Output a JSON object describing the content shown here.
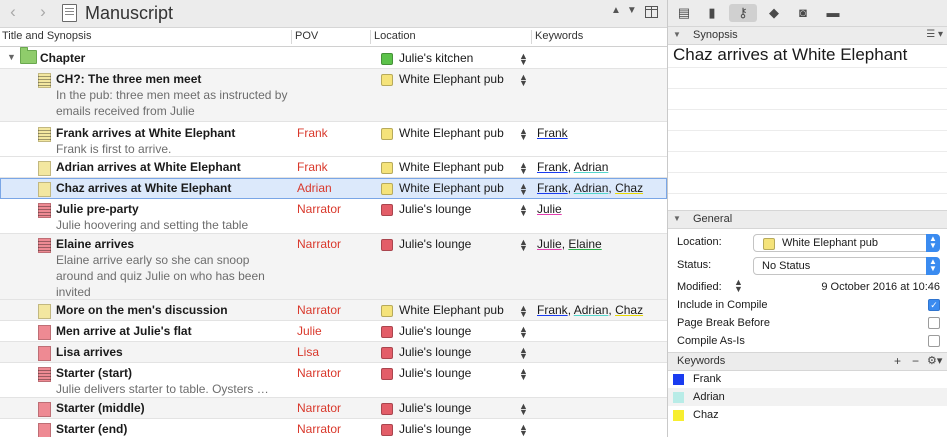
{
  "binder_header": {
    "title": "Manuscript",
    "back_icon": "chevron-left-icon",
    "forward_icon": "chevron-right-icon"
  },
  "columns": {
    "title": "Title and Synopsis",
    "pov": "POV",
    "location": "Location",
    "keywords": "Keywords"
  },
  "rows": [
    {
      "title": "Chapter",
      "synopsis": "",
      "pov": "",
      "location": "Julie's kitchen",
      "location_color": "#5cc24a",
      "keywords": [],
      "icon": "folder",
      "icon_color": "#8fcc6b"
    },
    {
      "title": "CH?: The three men meet",
      "synopsis": "In the pub: three men meet as instructed by emails received from Julie",
      "pov": "",
      "location": "White Elephant pub",
      "location_color": "#f5e37a",
      "keywords": [],
      "icon": "lines",
      "icon_color": "#f3e7a0"
    },
    {
      "title": "Frank arrives at White Elephant",
      "synopsis": "Frank is first to arrive.",
      "pov": "Frank",
      "location": "White Elephant pub",
      "location_color": "#f5e37a",
      "keywords": [
        "Frank"
      ],
      "icon": "lines",
      "icon_color": "#f3e7a0"
    },
    {
      "title": "Adrian arrives at White Elephant",
      "synopsis": "",
      "pov": "Frank",
      "location": "White Elephant pub",
      "location_color": "#f5e37a",
      "keywords": [
        "Frank",
        "Adrian"
      ],
      "icon": "page",
      "icon_color": "#f3e7a0"
    },
    {
      "title": "Chaz arrives at White Elephant",
      "synopsis": "",
      "pov": "Adrian",
      "location": "White Elephant pub",
      "location_color": "#f5e37a",
      "keywords": [
        "Frank",
        "Adrian",
        "Chaz"
      ],
      "icon": "page",
      "icon_color": "#f3e7a0"
    },
    {
      "title": "Julie pre-party",
      "synopsis": "Julie hoovering and setting the table",
      "pov": "Narrator",
      "location": "Julie's lounge",
      "location_color": "#e35d68",
      "keywords": [
        "Julie"
      ],
      "icon": "lines",
      "icon_color": "#ee8a93"
    },
    {
      "title": "Elaine arrives",
      "synopsis": "Elaine arrive early so she can snoop around and quiz Julie on who has been invited",
      "pov": "Narrator",
      "location": "Julie's lounge",
      "location_color": "#e35d68",
      "keywords": [
        "Julie",
        "Elaine"
      ],
      "icon": "lines",
      "icon_color": "#ee8a93"
    },
    {
      "title": "More on the men's discussion",
      "synopsis": "",
      "pov": "Narrator",
      "location": "White Elephant pub",
      "location_color": "#f5e37a",
      "keywords": [
        "Frank",
        "Adrian",
        "Chaz"
      ],
      "icon": "page",
      "icon_color": "#f3e7a0"
    },
    {
      "title": "Men arrive at Julie's flat",
      "synopsis": "",
      "pov": "Julie",
      "location": "Julie's lounge",
      "location_color": "#e35d68",
      "keywords": [],
      "icon": "page",
      "icon_color": "#ee8a93"
    },
    {
      "title": "Lisa arrives",
      "synopsis": "",
      "pov": "Lisa",
      "location": "Julie's lounge",
      "location_color": "#e35d68",
      "keywords": [],
      "icon": "page",
      "icon_color": "#ee8a93"
    },
    {
      "title": "Starter (start)",
      "synopsis": "Julie delivers starter to table. Oysters …",
      "pov": "Narrator",
      "location": "Julie's lounge",
      "location_color": "#e35d68",
      "keywords": [],
      "icon": "lines",
      "icon_color": "#ee8a93"
    },
    {
      "title": "Starter (middle)",
      "synopsis": "",
      "pov": "Narrator",
      "location": "Julie's lounge",
      "location_color": "#e35d68",
      "keywords": [],
      "icon": "page",
      "icon_color": "#ee8a93"
    },
    {
      "title": "Starter (end)",
      "synopsis": "",
      "pov": "Narrator",
      "location": "Julie's lounge",
      "location_color": "#e35d68",
      "keywords": [],
      "icon": "page",
      "icon_color": "#ee8a93"
    }
  ],
  "selected_row": 4,
  "inspector": {
    "synopsis_section": "Synopsis",
    "synopsis_title": "Chaz arrives at White Elephant",
    "general_section": "General",
    "location_label": "Location:",
    "location_value": "White Elephant pub",
    "status_label": "Status:",
    "status_value": "No Status",
    "modified_label": "Modified:",
    "modified_value": "9 October 2016 at 10:46",
    "include_compile_label": "Include in Compile",
    "include_compile": true,
    "page_break_label": "Page Break Before",
    "page_break": false,
    "compile_as_is_label": "Compile As-Is",
    "compile_as_is": false,
    "keywords_section": "Keywords",
    "keywords": [
      {
        "name": "Frank",
        "color": "#1a3cf0"
      },
      {
        "name": "Adrian",
        "color": "#b8ece7"
      },
      {
        "name": "Chaz",
        "color": "#f7ee2f"
      }
    ]
  },
  "toolbar_icons": [
    "notes-icon",
    "bookmark-icon",
    "key-icon",
    "tag-icon",
    "camera-icon",
    "comment-icon"
  ]
}
